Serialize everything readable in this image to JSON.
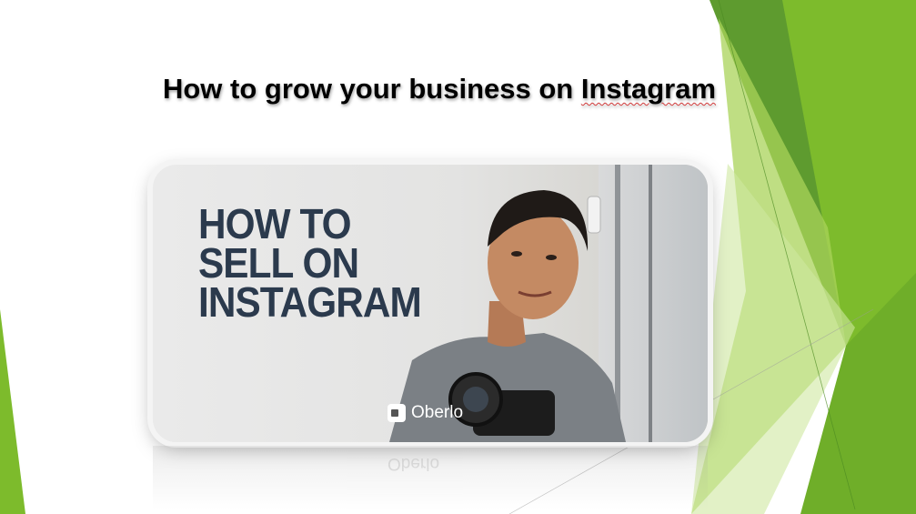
{
  "slide": {
    "title_prefix": "How to grow your business on ",
    "title_flagged_word": "Instagram"
  },
  "thumbnail": {
    "headline_lines": [
      "HOW TO",
      "SELL ON",
      "INSTAGRAM"
    ],
    "brand": "Oberlo"
  },
  "colors": {
    "accent_dark_green": "#5e9b2f",
    "accent_green": "#7dbb2c",
    "accent_light_green": "#b9dc7a",
    "headline_navy": "#2b3a4d"
  }
}
